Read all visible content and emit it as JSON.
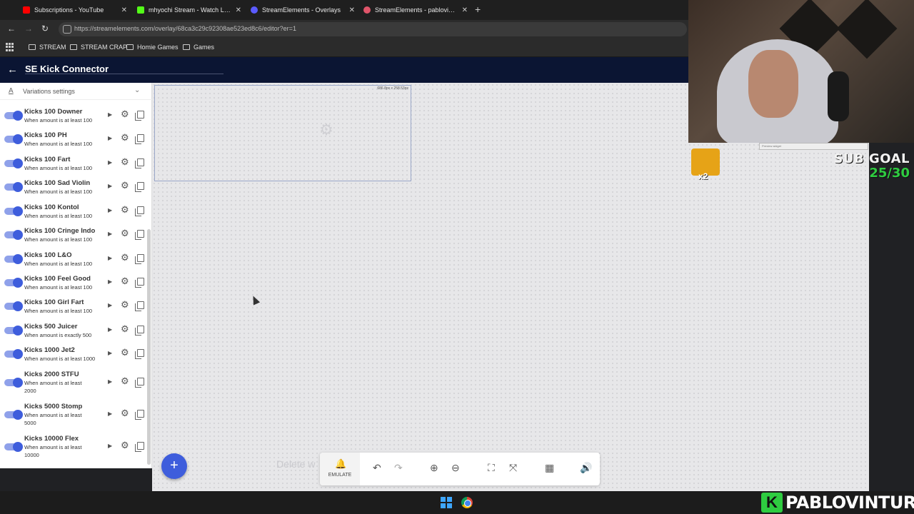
{
  "tabs": [
    {
      "label": "Subscriptions - YouTube",
      "color": "#ff0000"
    },
    {
      "label": "mhyochi Stream - Watch Live o",
      "color": "#53fc18"
    },
    {
      "label": "StreamElements - Overlays",
      "color": "#5b5bff"
    },
    {
      "label": "StreamElements - pablovintura",
      "color": "#e0556a"
    }
  ],
  "address": {
    "url": "https://streamelements.com/overlay/68ca3c29c92308ae523ed8c6/editor?er=1"
  },
  "bookmarks": [
    "STREAM",
    "STREAM CRAP",
    "Homie Games",
    "Games"
  ],
  "app": {
    "title": "SE Kick Connector"
  },
  "sidebar": {
    "section_label": "Variations settings",
    "items": [
      {
        "title": "Kicks 100 Downer",
        "sub": "When amount is at least 100"
      },
      {
        "title": "Kicks 100 PH",
        "sub": "When amount is at least 100"
      },
      {
        "title": "Kicks 100 Fart",
        "sub": "When amount is at least 100"
      },
      {
        "title": "Kicks 100 Sad Violin",
        "sub": "When amount is at least 100"
      },
      {
        "title": "Kicks 100 Kontol",
        "sub": "When amount is at least 100"
      },
      {
        "title": "Kicks 100 Cringe Indo",
        "sub": "When amount is at least 100"
      },
      {
        "title": "Kicks 100 L&O",
        "sub": "When amount is at least 100"
      },
      {
        "title": "Kicks 100 Feel Good",
        "sub": "When amount is at least 100"
      },
      {
        "title": "Kicks 100 Girl Fart",
        "sub": "When amount is at least 100"
      },
      {
        "title": "Kicks 500 Juicer",
        "sub": "When amount is exactly 500"
      },
      {
        "title": "Kicks 1000 Jet2",
        "sub": "When amount is at least 1000"
      },
      {
        "title": "Kicks 2000 STFU",
        "sub": "When amount is at least 2000"
      },
      {
        "title": "Kicks 5000 Stomp",
        "sub": "When amount is at least 5000"
      },
      {
        "title": "Kicks 10000 Flex",
        "sub": "When amount is at least 10000"
      }
    ]
  },
  "canvas": {
    "widget_size": "686.8px x 258.53px",
    "delete_hint": "Delete w"
  },
  "toolbar": {
    "emulate_label": "EMULATE"
  },
  "overlay": {
    "sub_goal_label": "SUB GOAL",
    "sub_goal_count": "25/30",
    "emote_multiplier": "x2",
    "preview_badge": "Preview widget"
  },
  "brand": {
    "k": "K",
    "name": "PABLOVINTURA"
  },
  "colors": {
    "accent": "#3e5ddc",
    "header": "#0b1533",
    "goal_green": "#2ecc40"
  }
}
